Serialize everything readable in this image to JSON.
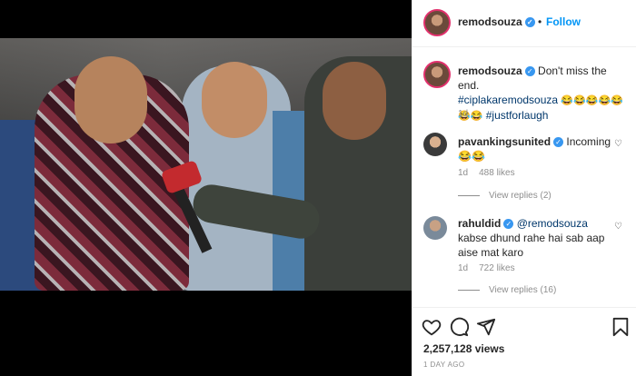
{
  "header": {
    "username": "remodsouza",
    "separator": "•",
    "follow_label": "Follow"
  },
  "caption": {
    "username": "remodsouza",
    "text": "Don't miss the end.",
    "hashtag1": "#ciplakaremodsouza",
    "emoji_row1": "😂😂😂😂😂",
    "emoji_row2": "😂😂",
    "hashtag2": "#justforlaugh",
    "age": "1d"
  },
  "comments": [
    {
      "username": "pavankingsunited",
      "text": "Incoming 😂😂",
      "age": "1d",
      "likes": "488 likes",
      "replies": "View replies (2)"
    },
    {
      "username": "rahuldid",
      "mention": "@remodsouza",
      "text": "kabse dhund rahe hai sab aap aise mat karo",
      "age": "1d",
      "likes": "722 likes",
      "replies": "View replies (16)"
    }
  ],
  "stats": {
    "views": "2,257,128 views",
    "posted": "1 DAY AGO"
  },
  "icons": {
    "like": "heart-icon",
    "comment": "comment-icon",
    "share": "share-icon",
    "save": "bookmark-icon",
    "verified": "verified-badge-icon"
  },
  "colors": {
    "accent": "#0095f6",
    "verified": "#3897f0",
    "hashtag": "#00376b",
    "muted": "#8e8e8e"
  }
}
